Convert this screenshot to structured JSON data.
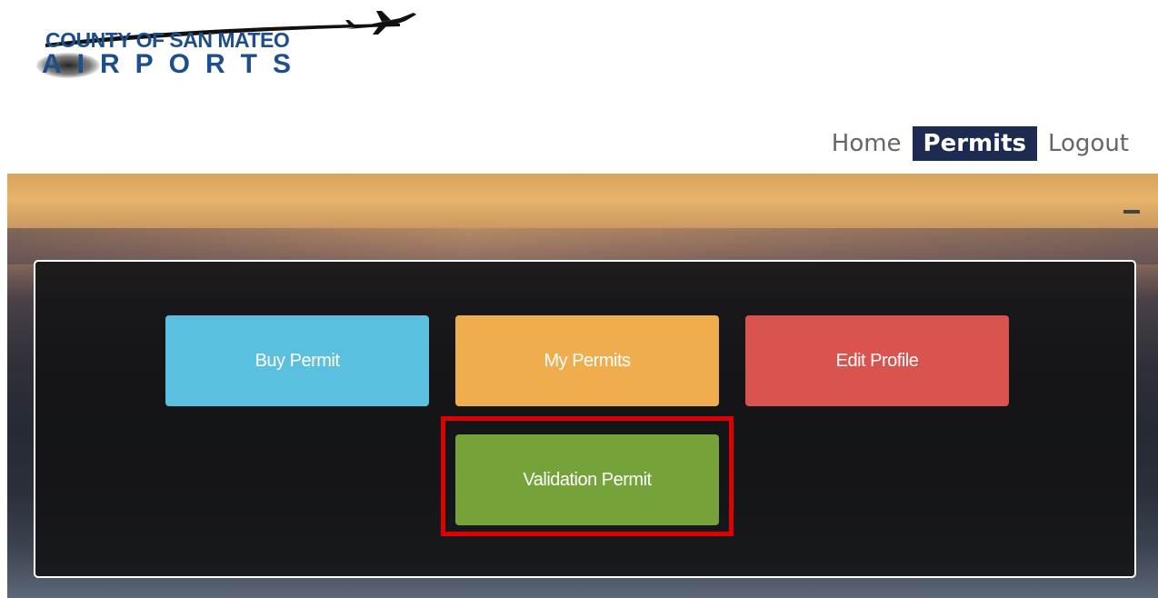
{
  "logo": {
    "top_text": "COUNTY OF SAN MATEO",
    "bottom_text": "AIRPORTS"
  },
  "nav": {
    "home": "Home",
    "permits": "Permits",
    "logout": "Logout",
    "active": "Permits"
  },
  "panel": {
    "buy_permit": "Buy Permit",
    "my_permits": "My Permits",
    "edit_profile": "Edit Profile",
    "validation_permit": "Validation Permit"
  },
  "colors": {
    "nav_active_bg": "#1c2b4f",
    "buy_permit": "#5bbfe0",
    "my_permits": "#f0ad4e",
    "edit_profile": "#d9534f",
    "validation_permit": "#76a23a",
    "highlight": "#e00000",
    "logo": "#1c4e8c"
  },
  "icons": {
    "logo_plane": "airplane-icon"
  }
}
